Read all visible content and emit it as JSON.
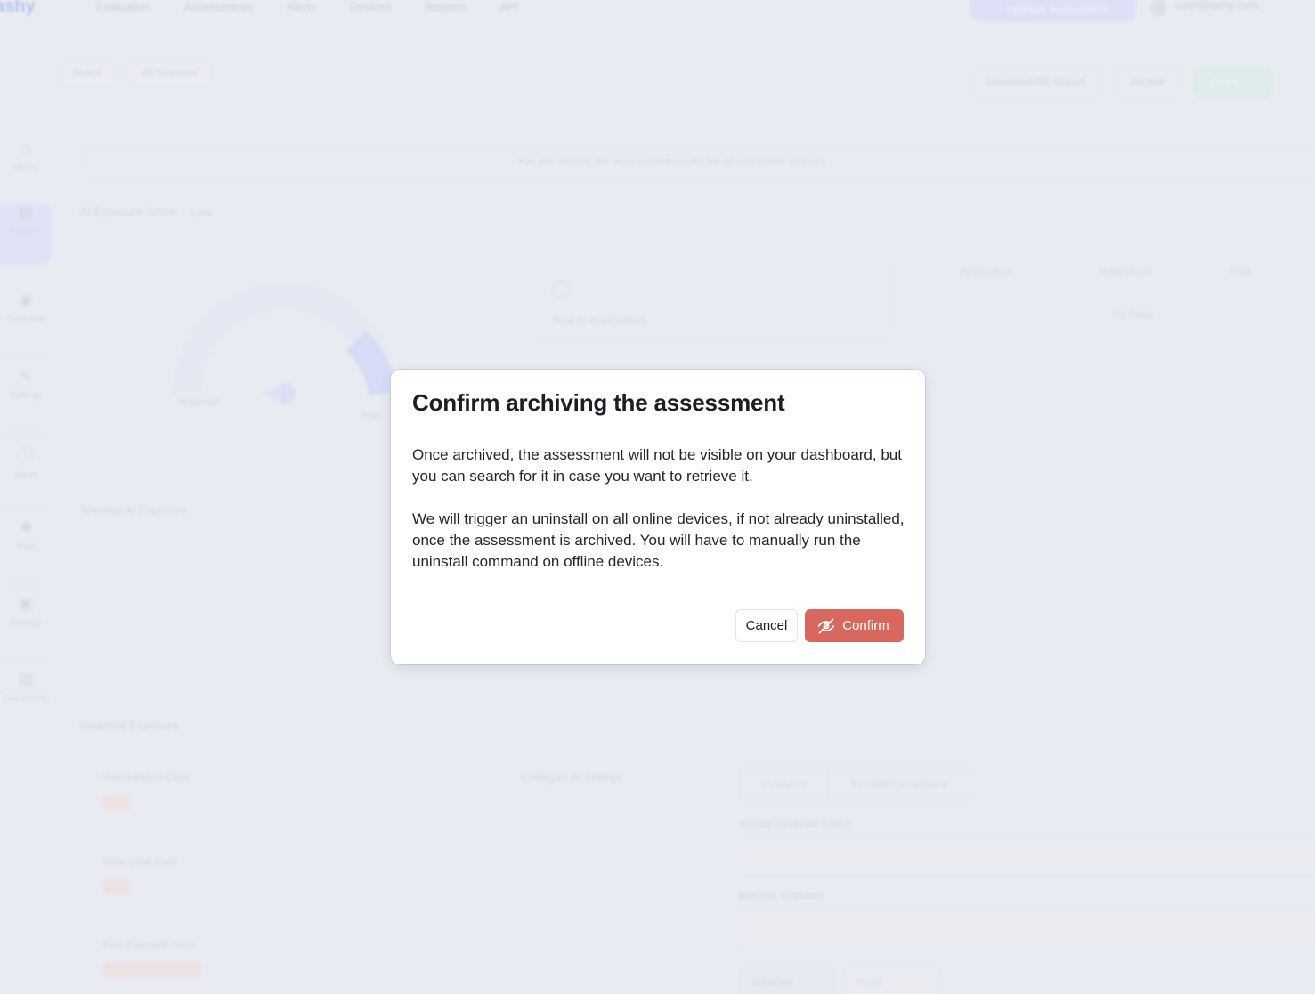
{
  "background": {
    "logo": "ashy",
    "nav": [
      "Evaluation",
      "Assessments",
      "Alerts",
      "Devices",
      "Reports",
      "API"
    ],
    "upgrade_label": "Upgrade Assessment",
    "user_email": "user@ashy.com",
    "chips": [
      "Status",
      "All Systems"
    ],
    "actions": [
      "Download AR Report",
      "Archive",
      "Share"
    ],
    "sidebar": [
      {
        "label": "Home",
        "icon": "home-icon",
        "glyph": "⌂"
      },
      {
        "label": "Reports",
        "icon": "grid-icon",
        "glyph": "▦"
      },
      {
        "label": "Overview",
        "icon": "eye-icon",
        "glyph": "◉"
      },
      {
        "label": "Settings",
        "icon": "edit-icon",
        "glyph": "✎"
      },
      {
        "label": "Alerts",
        "icon": "info-icon",
        "glyph": "ⓘ"
      },
      {
        "label": "Tools",
        "icon": "tool-icon",
        "glyph": "✱"
      },
      {
        "label": "Storage",
        "icon": "box-icon",
        "glyph": "▣"
      },
      {
        "label": "Documents",
        "icon": "doc-icon",
        "glyph": "▤"
      }
    ],
    "banner": "You are viewing the assessment results for all connected devices",
    "risk_score_title": "AI Exposure Score",
    "risk_score_sub": "Low",
    "gauge_low": "Moderate",
    "gauge_high": "High",
    "metric_label": "Total AI Applications",
    "table_headers": [
      "Application",
      "Total Users",
      "Risk"
    ],
    "no_data": "No Data",
    "shadow_title": "Shadow AI Exposure",
    "financial_title": "Financial Exposure",
    "fin_labels": [
      "Remediation Cost",
      "Data Leak Cost",
      "Fine Estimate Cost",
      "Configure AI Settings"
    ],
    "right_tabs": [
      "Overview",
      "Security Compliance"
    ],
    "field_labels": [
      "Annual Revenue (USD)",
      "Industry Standard"
    ],
    "bottom_buttons": [
      "Calculate",
      "Reset"
    ]
  },
  "modal": {
    "title": "Confirm archiving the assessment",
    "paragraph_1": "Once archived, the assessment will not be visible on your dashboard, but you can search for it in case you want to retrieve it.",
    "paragraph_2": "We will trigger an uninstall on all online devices, if not already uninstalled, once the assessment is archived. You will have to manually run the uninstall command on offline devices.",
    "cancel_label": "Cancel",
    "confirm_label": "Confirm",
    "confirm_icon": "eye-off-icon"
  },
  "colors": {
    "confirm_bg": "#d8685e",
    "accent": "#6d7cf0"
  }
}
